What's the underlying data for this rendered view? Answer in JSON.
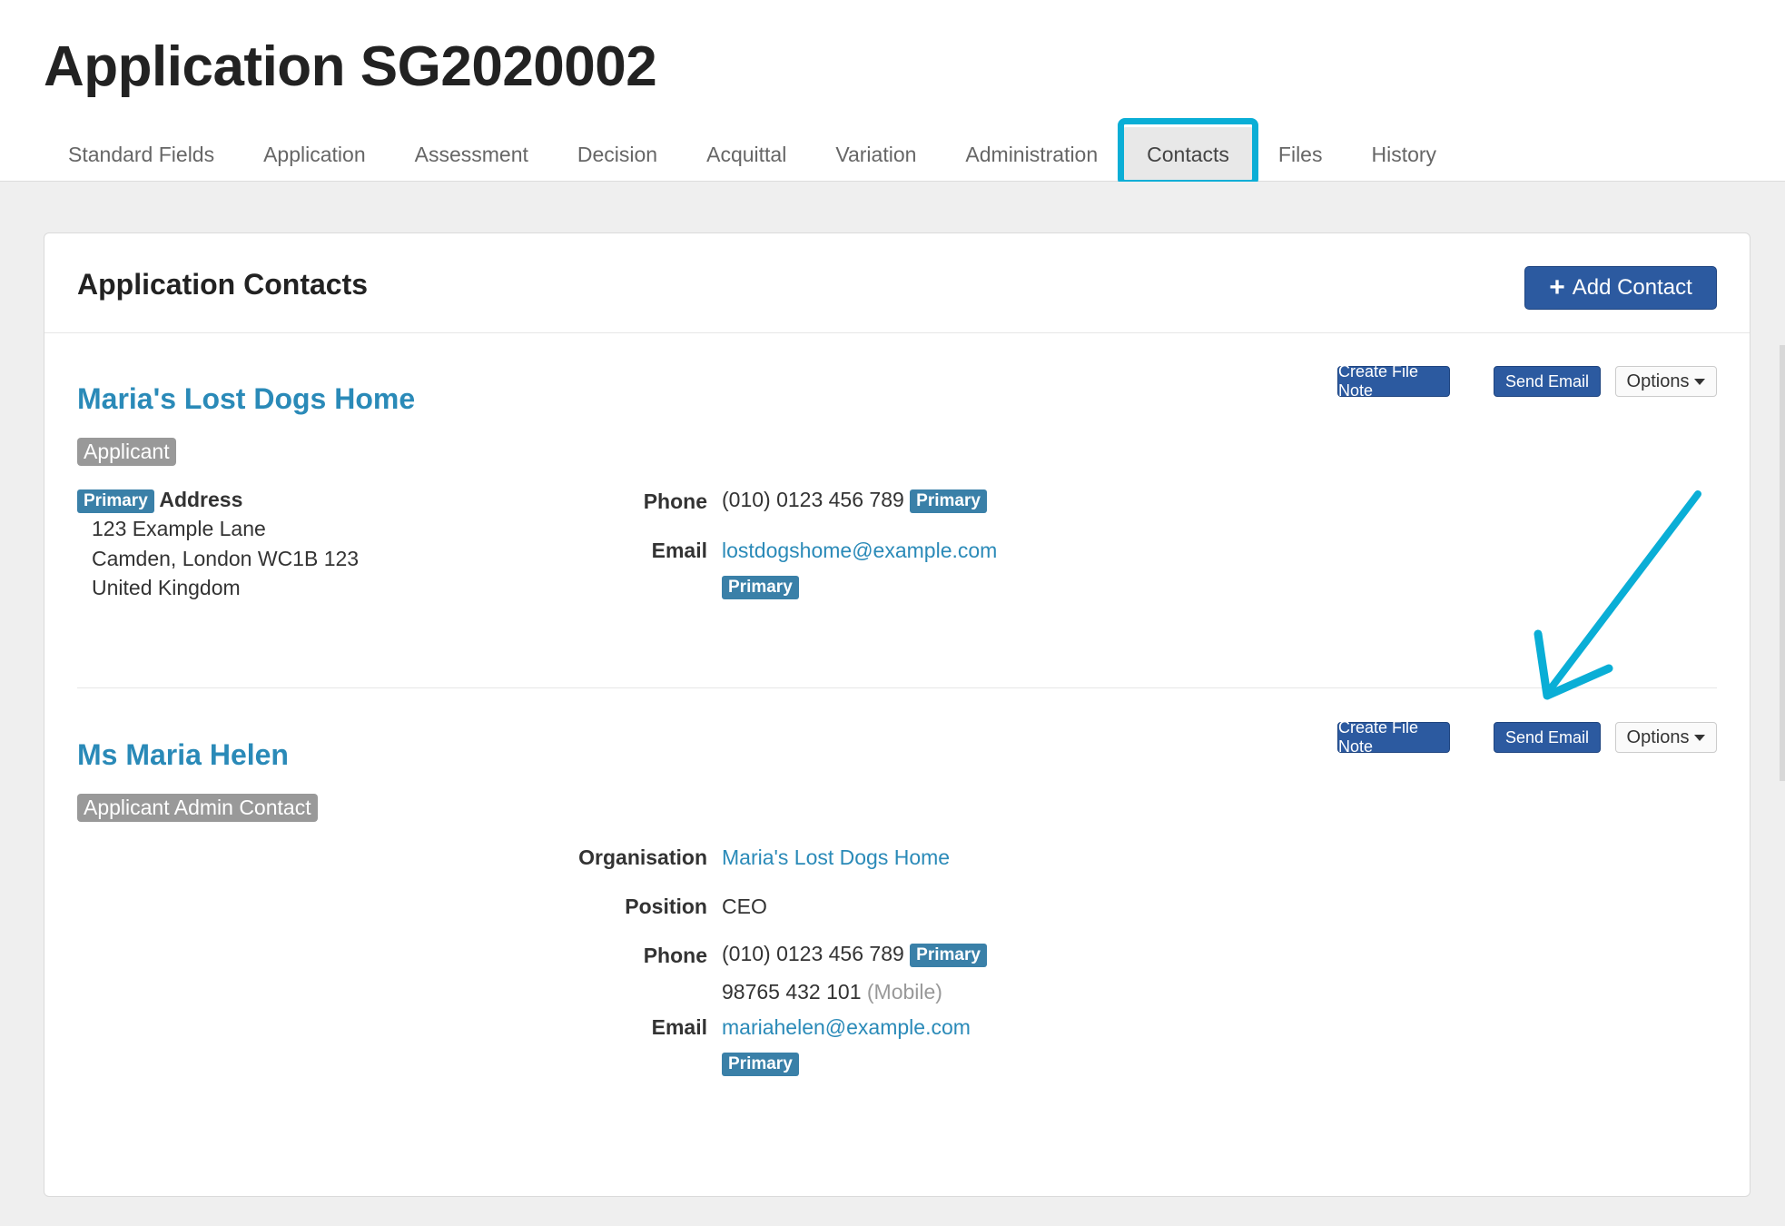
{
  "page": {
    "title": "Application SG2020002"
  },
  "tabs": [
    {
      "label": "Standard Fields"
    },
    {
      "label": "Application"
    },
    {
      "label": "Assessment"
    },
    {
      "label": "Decision"
    },
    {
      "label": "Acquittal"
    },
    {
      "label": "Variation"
    },
    {
      "label": "Administration"
    },
    {
      "label": "Contacts",
      "active": true
    },
    {
      "label": "Files"
    },
    {
      "label": "History"
    }
  ],
  "panel": {
    "title": "Application Contacts",
    "add_button": "Add Contact"
  },
  "contacts": [
    {
      "name": "Maria's Lost Dogs Home",
      "role": "Applicant",
      "address_badge": "Primary",
      "address_label": "Address",
      "address_lines": [
        "123 Example Lane",
        "Camden, London WC1B 123",
        "United Kingdom"
      ],
      "phone_label": "Phone",
      "phone": "(010) 0123 456 789",
      "phone_badge": "Primary",
      "email_label": "Email",
      "email": "lostdogshome@example.com",
      "email_badge": "Primary",
      "buttons": {
        "file_note": "Create File Note",
        "send_email": "Send Email",
        "options": "Options"
      }
    },
    {
      "name": "Ms Maria Helen",
      "role": "Applicant Admin Contact",
      "organisation_label": "Organisation",
      "organisation": "Maria's Lost Dogs Home",
      "position_label": "Position",
      "position": "CEO",
      "phone_label": "Phone",
      "phone": "(010) 0123 456 789",
      "phone_badge": "Primary",
      "mobile": "98765 432 101",
      "mobile_note": "(Mobile)",
      "email_label": "Email",
      "email": "mariahelen@example.com",
      "email_badge": "Primary",
      "buttons": {
        "file_note": "Create File Note",
        "send_email": "Send Email",
        "options": "Options"
      }
    }
  ],
  "colors": {
    "accent": "#0aaed6",
    "link": "#2a8ab8",
    "button": "#2c5aa0",
    "badge": "#3a80a8",
    "label": "#999999"
  }
}
